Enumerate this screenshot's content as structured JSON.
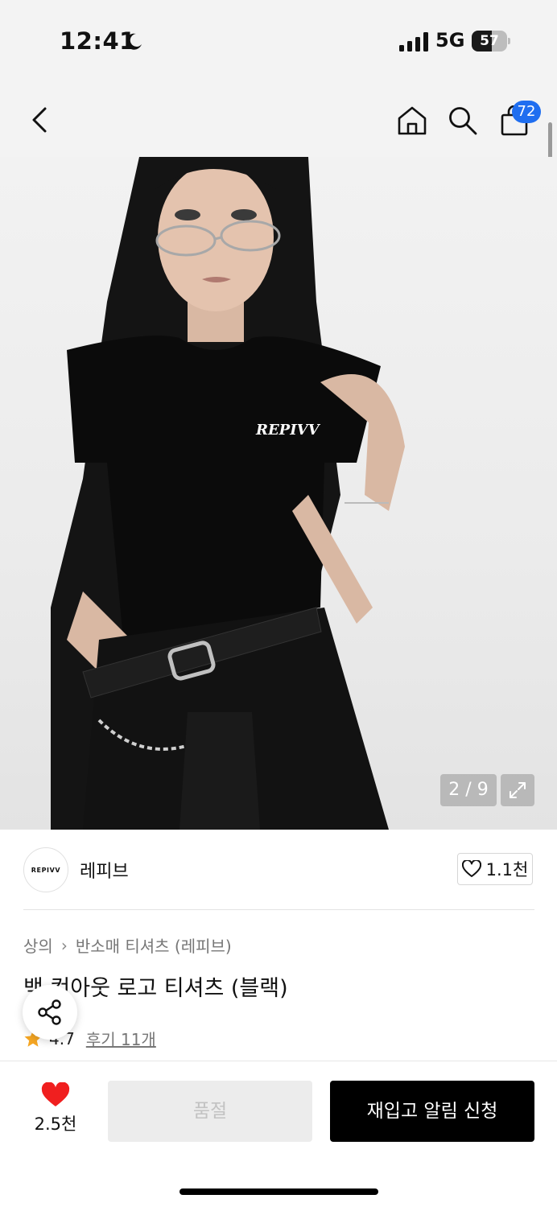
{
  "status_bar": {
    "time": "12:41",
    "network": "5G",
    "battery": 57
  },
  "nav": {
    "cart_count": "72"
  },
  "gallery": {
    "counter": "2 / 9",
    "shirt_print": "REPIVV"
  },
  "brand": {
    "logo_text": "REPIVV",
    "name": "레피브",
    "like_count": "1.1천"
  },
  "product": {
    "breadcrumb": [
      "상의",
      "반소매 티셔츠 (레피브)"
    ],
    "title": "백 컷아웃 로고 티셔츠 (블랙)",
    "rating": "4.7",
    "reviews": "후기 11개"
  },
  "bottom_bar": {
    "like_count": "2.5천",
    "soldout_label": "품절",
    "restock_label": "재입고 알림 신청"
  },
  "colors": {
    "accent_blue": "#1f6ef0",
    "heart_red": "#f01f1f",
    "star_orange": "#f5a623",
    "primary_black": "#000000"
  }
}
